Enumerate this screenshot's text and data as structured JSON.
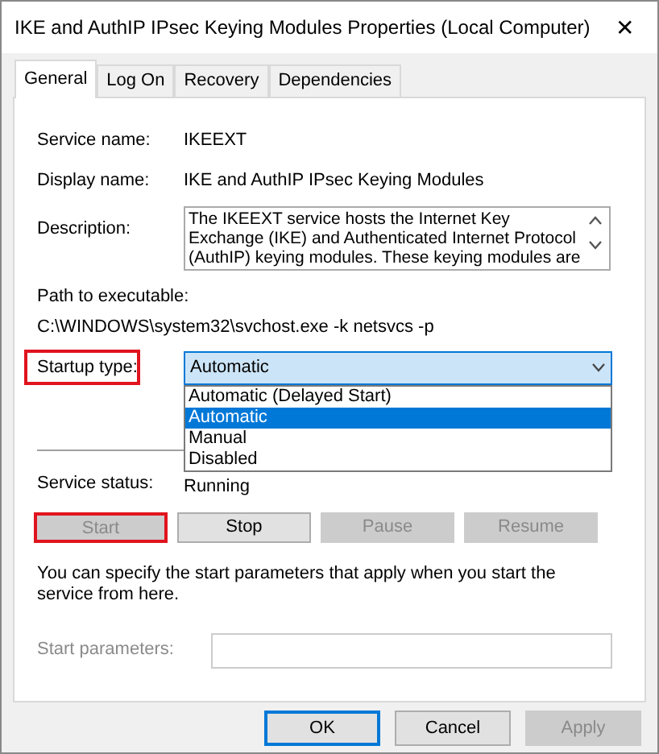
{
  "window": {
    "title": "IKE and AuthIP IPsec Keying Modules Properties (Local Computer)",
    "close": "✕"
  },
  "tabs": [
    {
      "label": "General",
      "selected": true
    },
    {
      "label": "Log On",
      "selected": false
    },
    {
      "label": "Recovery",
      "selected": false
    },
    {
      "label": "Dependencies",
      "selected": false
    }
  ],
  "service_name": {
    "label": "Service name:",
    "value": "IKEEXT"
  },
  "display_name": {
    "label": "Display name:",
    "value": "IKE and AuthIP IPsec Keying Modules"
  },
  "description": {
    "label": "Description:",
    "lines": [
      "The IKEEXT service hosts the Internet Key",
      "Exchange (IKE) and Authenticated Internet Protocol",
      "(AuthIP) keying modules. These keying modules are"
    ]
  },
  "path": {
    "label": "Path to executable:",
    "value": "C:\\WINDOWS\\system32\\svchost.exe -k netsvcs -p"
  },
  "startup_type": {
    "label": "Startup type:",
    "highlighted": true,
    "value": "Automatic",
    "expanded": true,
    "options": [
      {
        "label": "Automatic (Delayed Start)",
        "selected": false
      },
      {
        "label": "Automatic",
        "selected": true
      },
      {
        "label": "Manual",
        "selected": false
      },
      {
        "label": "Disabled",
        "selected": false
      }
    ]
  },
  "service_status": {
    "label": "Service status:",
    "value": "Running"
  },
  "service_buttons": [
    {
      "label": "Start",
      "disabled": true,
      "highlighted": true
    },
    {
      "label": "Stop",
      "disabled": false,
      "highlighted": false
    },
    {
      "label": "Pause",
      "disabled": true,
      "highlighted": false
    },
    {
      "label": "Resume",
      "disabled": true,
      "highlighted": false
    }
  ],
  "hint": "You can specify the start parameters that apply when you start the service from here.",
  "start_parameters": {
    "label": "Start parameters:",
    "disabled": true
  },
  "dialog_buttons": [
    {
      "label": "OK",
      "default": true,
      "disabled": false
    },
    {
      "label": "Cancel",
      "default": false,
      "disabled": false
    },
    {
      "label": "Apply",
      "default": false,
      "disabled": true
    }
  ]
}
